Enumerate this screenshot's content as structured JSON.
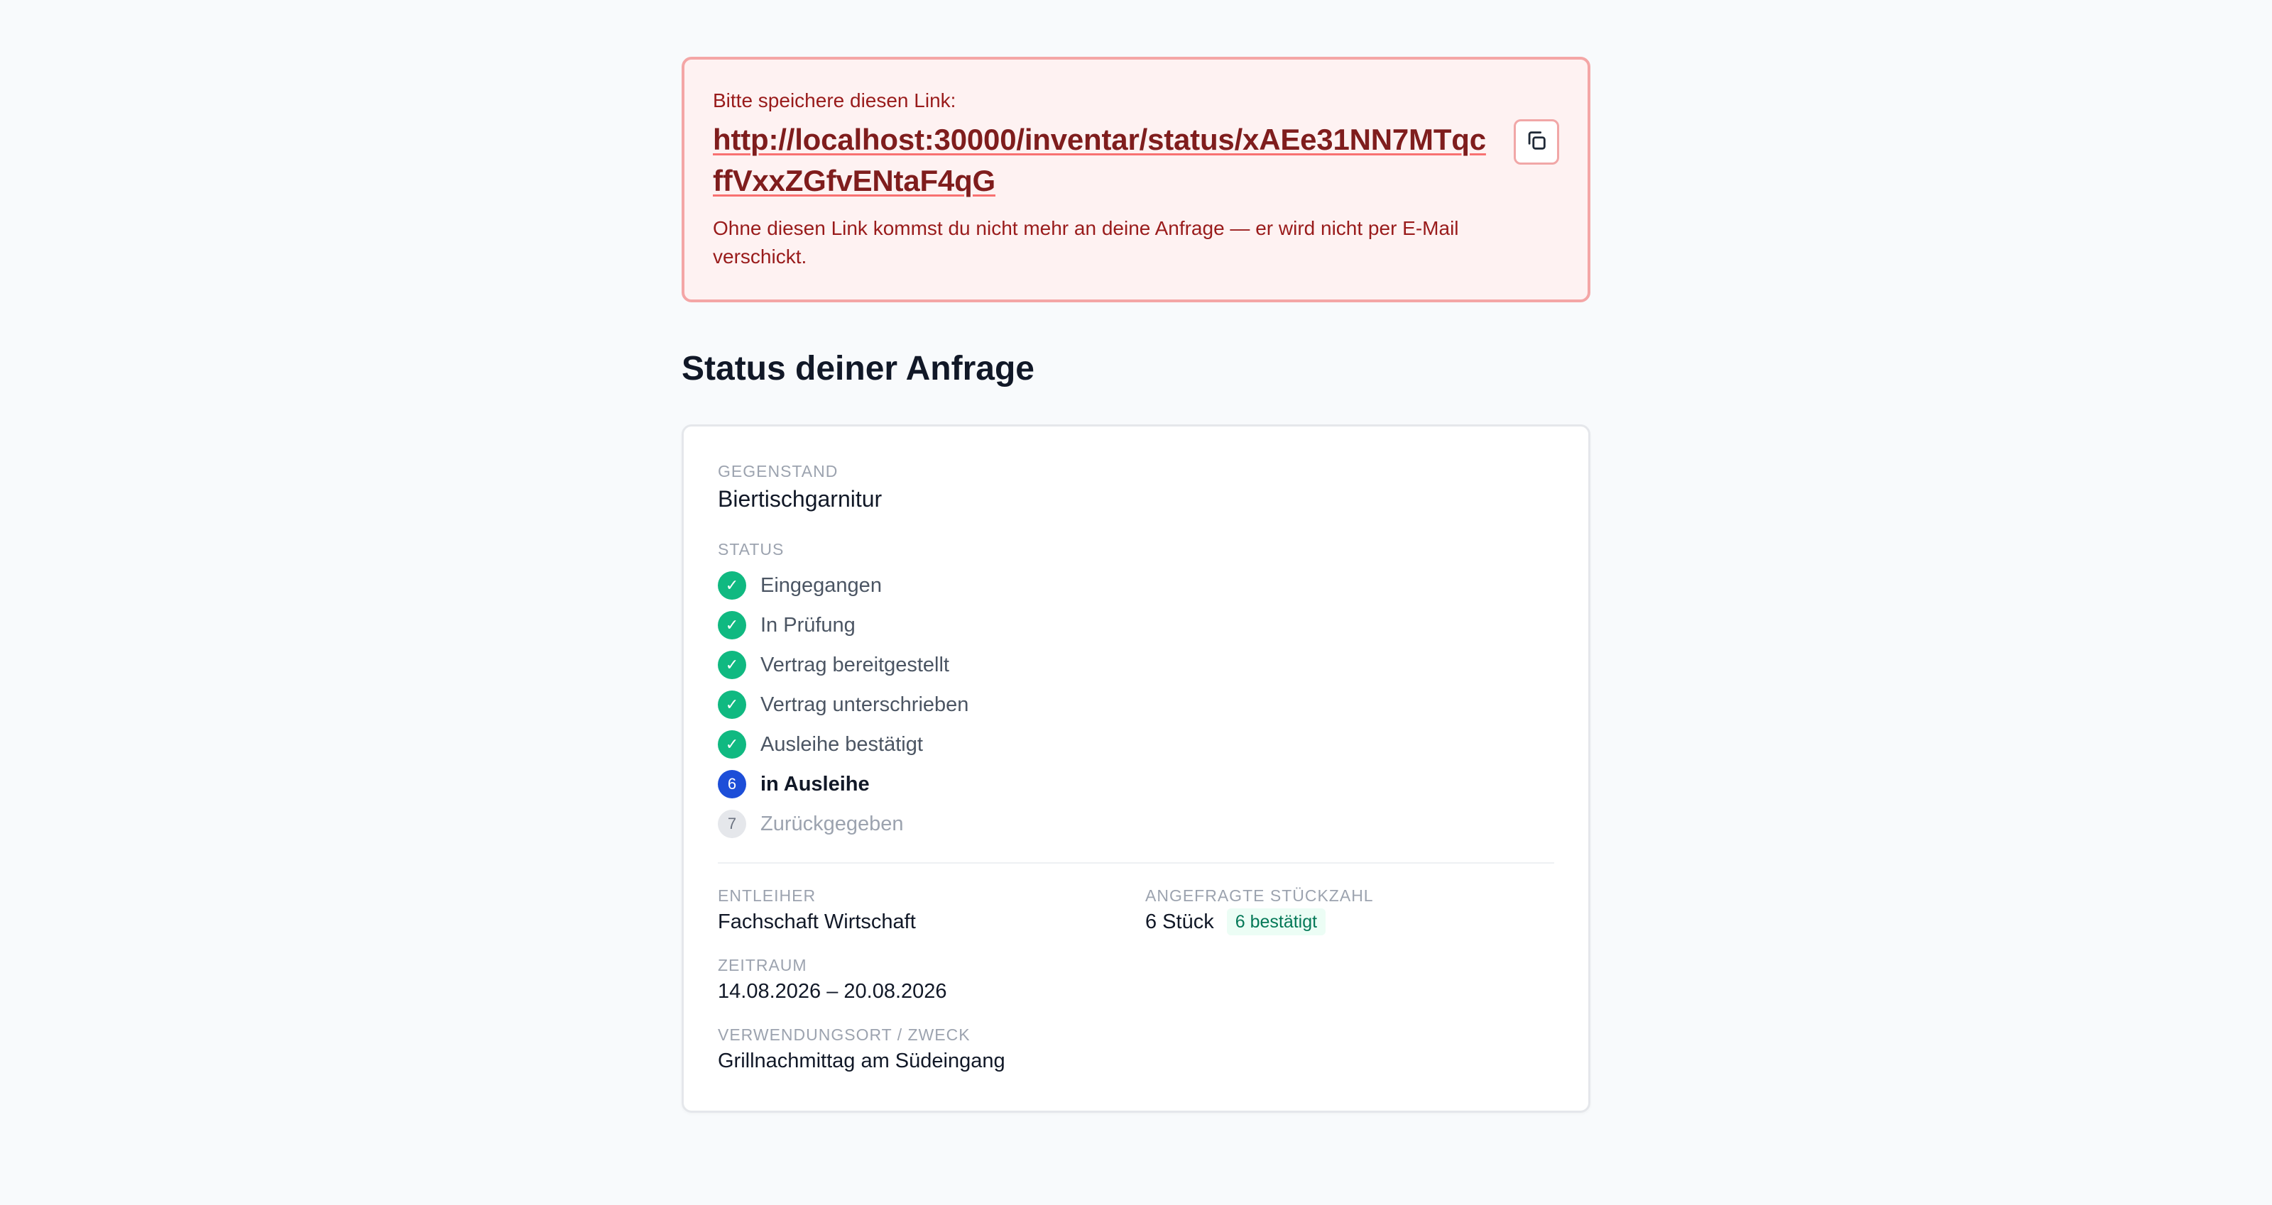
{
  "notice": {
    "intro": "Bitte speichere diesen Link:",
    "url": "http://localhost:30000/inventar/status/xAEe31NN7MTqcffVxxZGfvENtaF4qG",
    "note": "Ohne diesen Link kommst du nicht mehr an deine Anfrage — er wird nicht per E-Mail verschickt.",
    "copy_icon": "copy-icon"
  },
  "page": {
    "title": "Status deiner Anfrage"
  },
  "card": {
    "item_label": "GEGENSTAND",
    "item_name": "Biertischgarnitur",
    "status_label": "STATUS",
    "steps": [
      {
        "marker": "✓",
        "label": "Eingegangen",
        "state": "done"
      },
      {
        "marker": "✓",
        "label": "In Prüfung",
        "state": "done"
      },
      {
        "marker": "✓",
        "label": "Vertrag bereitgestellt",
        "state": "done"
      },
      {
        "marker": "✓",
        "label": "Vertrag unterschrieben",
        "state": "done"
      },
      {
        "marker": "✓",
        "label": "Ausleihe bestätigt",
        "state": "done"
      },
      {
        "marker": "6",
        "label": "in Ausleihe",
        "state": "current"
      },
      {
        "marker": "7",
        "label": "Zurückgegeben",
        "state": "pending"
      }
    ],
    "borrower_label": "ENTLEIHER",
    "borrower": "Fachschaft Wirtschaft",
    "quantity_label": "ANGEFRAGTE STÜCKZAHL",
    "quantity": "6 Stück",
    "quantity_badge": "6 bestätigt",
    "period_label": "ZEITRAUM",
    "period": "14.08.2026 – 20.08.2026",
    "purpose_label": "VERWENDUNGSORT / ZWECK",
    "purpose": "Grillnachmittag am Südeingang"
  },
  "colors": {
    "done": "#10b981",
    "current": "#1d4ed8",
    "pending": "#e5e7eb",
    "alert_bg": "#fef2f2",
    "alert_border": "#f4a6a6",
    "alert_text": "#991b1b"
  }
}
